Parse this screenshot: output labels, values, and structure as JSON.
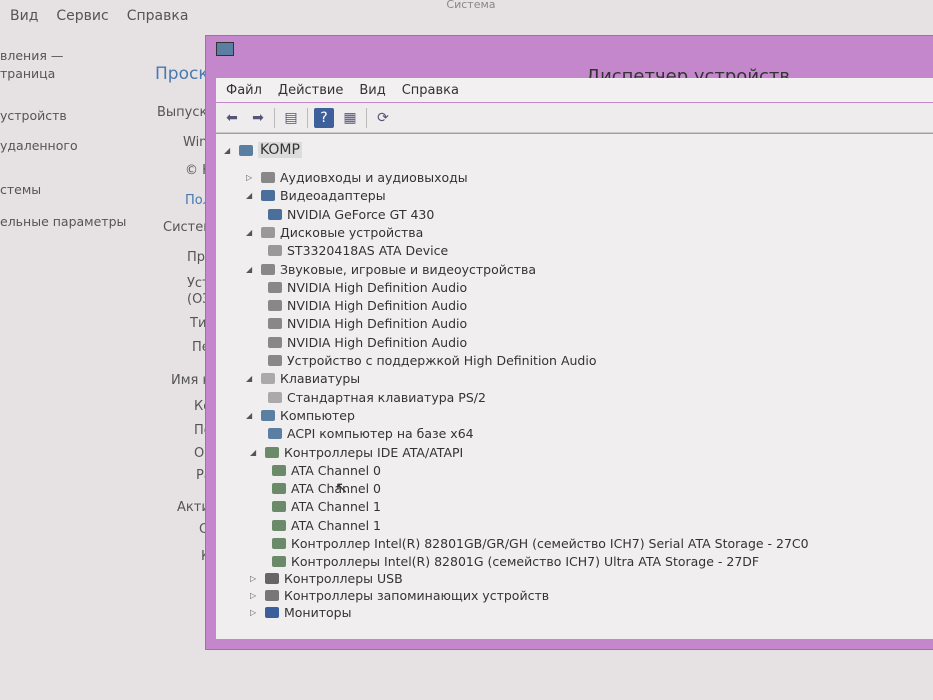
{
  "background_window": {
    "menu": [
      "Вид",
      "Сервис",
      "Справка"
    ],
    "left_links": [
      "вления —",
      "траница",
      "устройств",
      "удаленного",
      "стемы",
      "ельные параметры"
    ],
    "content": [
      "Проск",
      "Выпуск",
      "Win",
      "© K",
      "Пол",
      "Систем",
      "Про",
      "Уста",
      "(ОЗ",
      "Тип",
      "Пер",
      "Имя ко",
      "Ком",
      "Пол",
      "Опи",
      "Раб",
      "Активаı",
      "Сис",
      "Код"
    ],
    "top_title": "Система"
  },
  "window": {
    "title": "Диспетчер устройств",
    "menu": [
      "Файл",
      "Действие",
      "Вид",
      "Справка"
    ],
    "toolbar": [
      "back-icon",
      "forward-icon",
      "properties-icon",
      "help-icon",
      "view-icon",
      "scan-icon"
    ]
  },
  "tree": [
    {
      "label": "KOMP",
      "level": 0,
      "expanded": true,
      "icon": "computer-icon"
    },
    {
      "label": "Аудиовходы и аудиовыходы",
      "level": 1,
      "expanded": false,
      "icon": "speaker-icon"
    },
    {
      "label": "Видеоадаптеры",
      "level": 1,
      "expanded": true,
      "icon": "display-icon"
    },
    {
      "label": "NVIDIA GeForce GT 430",
      "level": 2,
      "icon": "display-icon"
    },
    {
      "label": "Дисковые устройства",
      "level": 1,
      "expanded": true,
      "icon": "disk-icon"
    },
    {
      "label": "ST3320418AS ATA Device",
      "level": 2,
      "icon": "disk-icon"
    },
    {
      "label": "Звуковые, игровые и видеоустройства",
      "level": 1,
      "expanded": true,
      "icon": "speaker-icon"
    },
    {
      "label": "NVIDIA High Definition Audio",
      "level": 2,
      "icon": "speaker-icon"
    },
    {
      "label": "NVIDIA High Definition Audio",
      "level": 2,
      "icon": "speaker-icon"
    },
    {
      "label": "NVIDIA High Definition Audio",
      "level": 2,
      "icon": "speaker-icon"
    },
    {
      "label": "NVIDIA High Definition Audio",
      "level": 2,
      "icon": "speaker-icon"
    },
    {
      "label": "Устройство с поддержкой High Definition Audio",
      "level": 2,
      "icon": "speaker-icon"
    },
    {
      "label": "Клавиатуры",
      "level": 1,
      "expanded": true,
      "icon": "keyboard-icon"
    },
    {
      "label": "Стандартная клавиатура PS/2",
      "level": 2,
      "icon": "keyboard-icon"
    },
    {
      "label": "Компьютер",
      "level": 1,
      "expanded": true,
      "icon": "computer-icon"
    },
    {
      "label": "ACPI компьютер на базе x64",
      "level": 2,
      "icon": "computer-icon"
    },
    {
      "label": "Контроллеры IDE ATA/ATAPI",
      "level": 1,
      "expanded": true,
      "icon": "controller-icon"
    },
    {
      "label": "ATA Channel 0",
      "level": 2,
      "icon": "controller-icon"
    },
    {
      "label": "ATA Channel 0",
      "level": 2,
      "icon": "controller-icon"
    },
    {
      "label": "ATA Channel 1",
      "level": 2,
      "icon": "controller-icon"
    },
    {
      "label": "ATA Channel 1",
      "level": 2,
      "icon": "controller-icon"
    },
    {
      "label": "Контроллер Intel(R) 82801GB/GR/GH (семейство ICH7) Serial ATA Storage - 27C0",
      "level": 2,
      "icon": "controller-icon"
    },
    {
      "label": "Контроллеры Intel(R) 82801G (семейство ICH7) Ultra ATA Storage - 27DF",
      "level": 2,
      "icon": "controller-icon"
    },
    {
      "label": "Контроллеры USB",
      "level": 1,
      "expanded": false,
      "icon": "usb-icon"
    },
    {
      "label": "Контроллеры запоминающих устройств",
      "level": 1,
      "expanded": false,
      "icon": "storage-icon"
    },
    {
      "label": "Мониторы",
      "level": 1,
      "expanded": false,
      "icon": "monitor-icon"
    }
  ]
}
